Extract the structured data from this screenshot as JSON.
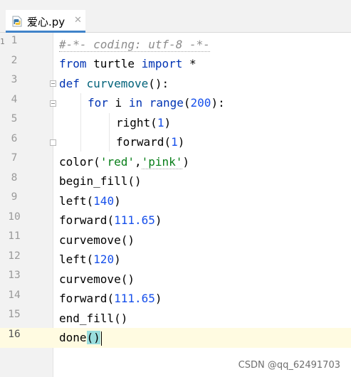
{
  "tab": {
    "filename": "爱心.py",
    "close": "✕",
    "icon": "python-file-icon"
  },
  "gutter": {
    "marker": "1"
  },
  "line_numbers": [
    "1",
    "2",
    "3",
    "4",
    "5",
    "6",
    "7",
    "8",
    "9",
    "10",
    "11",
    "12",
    "13",
    "14",
    "15",
    "16"
  ],
  "code": {
    "l1": "#-*- coding: utf-8 -*-",
    "l2_kw1": "from",
    "l2_mid": " turtle ",
    "l2_kw2": "import",
    "l2_end": " *",
    "l3_kw": "def",
    "l3_fn": "curvemove",
    "l3_end": "():",
    "l4_kw1": "for",
    "l4_mid": " i ",
    "l4_kw2": "in",
    "l4_sp": " ",
    "l4_fn": "range",
    "l4_p1": "(",
    "l4_num": "200",
    "l4_p2": "):",
    "l5_fn": "right",
    "l5_p1": "(",
    "l5_num": "1",
    "l5_p2": ")",
    "l6_fn": "forward",
    "l6_p1": "(",
    "l6_num": "1",
    "l6_p2": ")",
    "l7_fn": "color",
    "l7_p1": "(",
    "l7_s1": "'red'",
    "l7_c": ",",
    "l7_s2": "'pink'",
    "l7_p2": ")",
    "l8": "begin_fill()",
    "l9_fn": "left",
    "l9_p1": "(",
    "l9_num": "140",
    "l9_p2": ")",
    "l10_fn": "forward",
    "l10_p1": "(",
    "l10_num": "111.65",
    "l10_p2": ")",
    "l11": "curvemove()",
    "l12_fn": "left",
    "l12_p1": "(",
    "l12_num": "120",
    "l12_p2": ")",
    "l13": "curvemove()",
    "l14_fn": "forward",
    "l14_p1": "(",
    "l14_num": "111.65",
    "l14_p2": ")",
    "l15": "end_fill()",
    "l16_fn": "done",
    "l16_b1": "(",
    "l16_b2": ")"
  },
  "current_line": "16",
  "watermark": "CSDN @qq_62491703",
  "colors": {
    "keyword": "#0033b3",
    "number": "#1750eb",
    "string": "#067d17",
    "comment": "#8c8c8c",
    "function": "#00627a",
    "tab_underline": "#4083c9"
  }
}
